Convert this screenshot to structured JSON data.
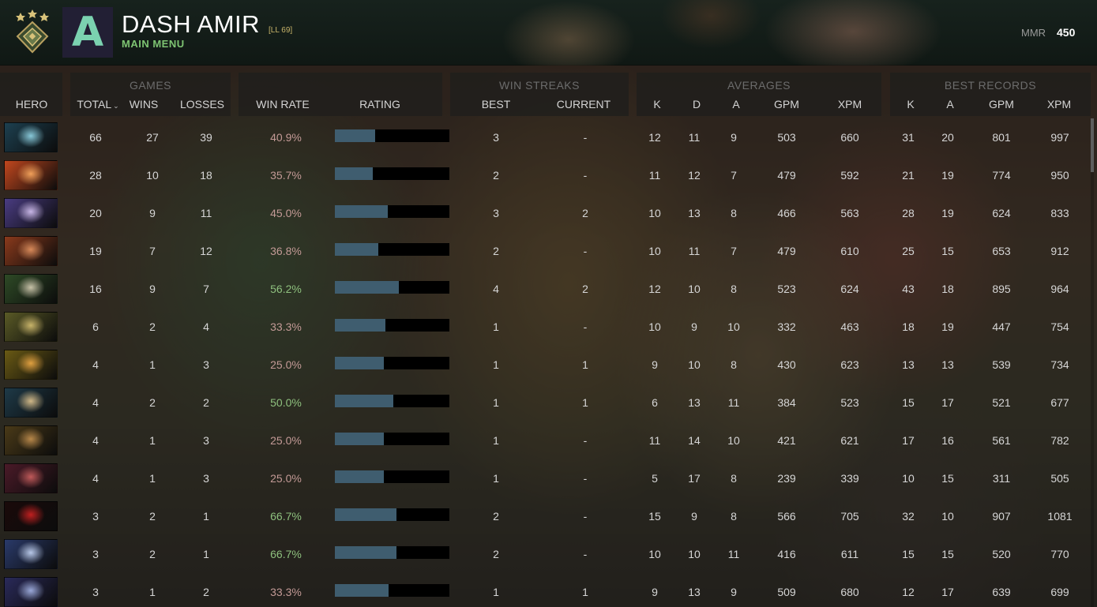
{
  "player": {
    "initial": "A",
    "name": "DASH AMIR",
    "level": "[LL 69]",
    "subtitle": "MAIN MENU",
    "mmr_label": "MMR",
    "mmr_value": "450"
  },
  "header": {
    "groups": {
      "games": "GAMES",
      "win_streaks": "WIN STREAKS",
      "averages": "AVERAGES",
      "best_records": "BEST RECORDS"
    },
    "columns": {
      "hero": "HERO",
      "total": "TOTAL",
      "wins": "WINS",
      "losses": "LOSSES",
      "win_rate": "WIN RATE",
      "rating": "RATING",
      "best": "BEST",
      "current": "CURRENT",
      "avg_k": "K",
      "avg_d": "D",
      "avg_a": "A",
      "avg_gpm": "GPM",
      "avg_xpm": "XPM",
      "best_k": "K",
      "best_a": "A",
      "best_gpm": "GPM",
      "best_xpm": "XPM"
    },
    "sort_icon": "chevron-down-icon"
  },
  "rows": [
    {
      "hero": "hero-1",
      "colors": [
        "#1d4050",
        "#88c8d8"
      ],
      "total": "66",
      "wins": "27",
      "losses": "39",
      "win_rate": "40.9%",
      "rating": 0.35,
      "best": "3",
      "current": "-",
      "k": "12",
      "d": "11",
      "a": "9",
      "gpm": "503",
      "xpm": "660",
      "bk": "31",
      "ba": "20",
      "bgpm": "801",
      "bxpm": "997"
    },
    {
      "hero": "hero-2",
      "colors": [
        "#c2471e",
        "#f0a05a"
      ],
      "total": "28",
      "wins": "10",
      "losses": "18",
      "win_rate": "35.7%",
      "rating": 0.33,
      "best": "2",
      "current": "-",
      "k": "11",
      "d": "12",
      "a": "7",
      "gpm": "479",
      "xpm": "592",
      "bk": "21",
      "ba": "19",
      "bgpm": "774",
      "bxpm": "950"
    },
    {
      "hero": "hero-3",
      "colors": [
        "#4a3c82",
        "#c8b6e6"
      ],
      "total": "20",
      "wins": "9",
      "losses": "11",
      "win_rate": "45.0%",
      "rating": 0.46,
      "best": "3",
      "current": "2",
      "k": "10",
      "d": "13",
      "a": "8",
      "gpm": "466",
      "xpm": "563",
      "bk": "28",
      "ba": "19",
      "bgpm": "624",
      "bxpm": "833"
    },
    {
      "hero": "hero-4",
      "colors": [
        "#8a3a1c",
        "#d88a5a"
      ],
      "total": "19",
      "wins": "7",
      "losses": "12",
      "win_rate": "36.8%",
      "rating": 0.38,
      "best": "2",
      "current": "-",
      "k": "10",
      "d": "11",
      "a": "7",
      "gpm": "479",
      "xpm": "610",
      "bk": "25",
      "ba": "15",
      "bgpm": "653",
      "bxpm": "912"
    },
    {
      "hero": "hero-5",
      "colors": [
        "#2e4a26",
        "#c8c2a8"
      ],
      "total": "16",
      "wins": "9",
      "losses": "7",
      "win_rate": "56.2%",
      "rating": 0.56,
      "best": "4",
      "current": "2",
      "k": "12",
      "d": "10",
      "a": "8",
      "gpm": "523",
      "xpm": "624",
      "bk": "43",
      "ba": "18",
      "bgpm": "895",
      "bxpm": "964"
    },
    {
      "hero": "hero-6",
      "colors": [
        "#5a5a26",
        "#c8b46a"
      ],
      "total": "6",
      "wins": "2",
      "losses": "4",
      "win_rate": "33.3%",
      "rating": 0.44,
      "best": "1",
      "current": "-",
      "k": "10",
      "d": "9",
      "a": "10",
      "gpm": "332",
      "xpm": "463",
      "bk": "18",
      "ba": "19",
      "bgpm": "447",
      "bxpm": "754"
    },
    {
      "hero": "hero-7",
      "colors": [
        "#6a5a14",
        "#e0a040"
      ],
      "total": "4",
      "wins": "1",
      "losses": "3",
      "win_rate": "25.0%",
      "rating": 0.43,
      "best": "1",
      "current": "1",
      "k": "9",
      "d": "10",
      "a": "8",
      "gpm": "430",
      "xpm": "623",
      "bk": "13",
      "ba": "13",
      "bgpm": "539",
      "bxpm": "734"
    },
    {
      "hero": "hero-8",
      "colors": [
        "#1e3a48",
        "#d0b888"
      ],
      "total": "4",
      "wins": "2",
      "losses": "2",
      "win_rate": "50.0%",
      "rating": 0.51,
      "best": "1",
      "current": "1",
      "k": "6",
      "d": "13",
      "a": "11",
      "gpm": "384",
      "xpm": "523",
      "bk": "15",
      "ba": "17",
      "bgpm": "521",
      "bxpm": "677"
    },
    {
      "hero": "hero-9",
      "colors": [
        "#4a3a18",
        "#b8884a"
      ],
      "total": "4",
      "wins": "1",
      "losses": "3",
      "win_rate": "25.0%",
      "rating": 0.43,
      "best": "1",
      "current": "-",
      "k": "11",
      "d": "14",
      "a": "10",
      "gpm": "421",
      "xpm": "621",
      "bk": "17",
      "ba": "16",
      "bgpm": "561",
      "bxpm": "782"
    },
    {
      "hero": "hero-10",
      "colors": [
        "#4a1a28",
        "#c05a5a"
      ],
      "total": "4",
      "wins": "1",
      "losses": "3",
      "win_rate": "25.0%",
      "rating": 0.43,
      "best": "1",
      "current": "-",
      "k": "5",
      "d": "17",
      "a": "8",
      "gpm": "239",
      "xpm": "339",
      "bk": "10",
      "ba": "15",
      "bgpm": "311",
      "bxpm": "505"
    },
    {
      "hero": "hero-11",
      "colors": [
        "#1a0a0a",
        "#c02020"
      ],
      "total": "3",
      "wins": "2",
      "losses": "1",
      "win_rate": "66.7%",
      "rating": 0.54,
      "best": "2",
      "current": "-",
      "k": "15",
      "d": "9",
      "a": "8",
      "gpm": "566",
      "xpm": "705",
      "bk": "32",
      "ba": "10",
      "bgpm": "907",
      "bxpm": "1081"
    },
    {
      "hero": "hero-12",
      "colors": [
        "#2a3a6a",
        "#b8c8e8"
      ],
      "total": "3",
      "wins": "2",
      "losses": "1",
      "win_rate": "66.7%",
      "rating": 0.54,
      "best": "2",
      "current": "-",
      "k": "10",
      "d": "10",
      "a": "11",
      "gpm": "416",
      "xpm": "611",
      "bk": "15",
      "ba": "15",
      "bgpm": "520",
      "bxpm": "770"
    },
    {
      "hero": "hero-13",
      "colors": [
        "#2a2a5a",
        "#9aa8d8"
      ],
      "total": "3",
      "wins": "1",
      "losses": "2",
      "win_rate": "33.3%",
      "rating": 0.47,
      "best": "1",
      "current": "1",
      "k": "9",
      "d": "13",
      "a": "9",
      "gpm": "509",
      "xpm": "680",
      "bk": "12",
      "ba": "17",
      "bgpm": "639",
      "bxpm": "699"
    }
  ],
  "colors": {
    "accent_green": "#7ec472",
    "rating_fill": "#3f5d6f",
    "win_rate_low": "#c39a96",
    "win_rate_high": "#8ec07e",
    "avatar_letter": "#7bd2b0"
  }
}
